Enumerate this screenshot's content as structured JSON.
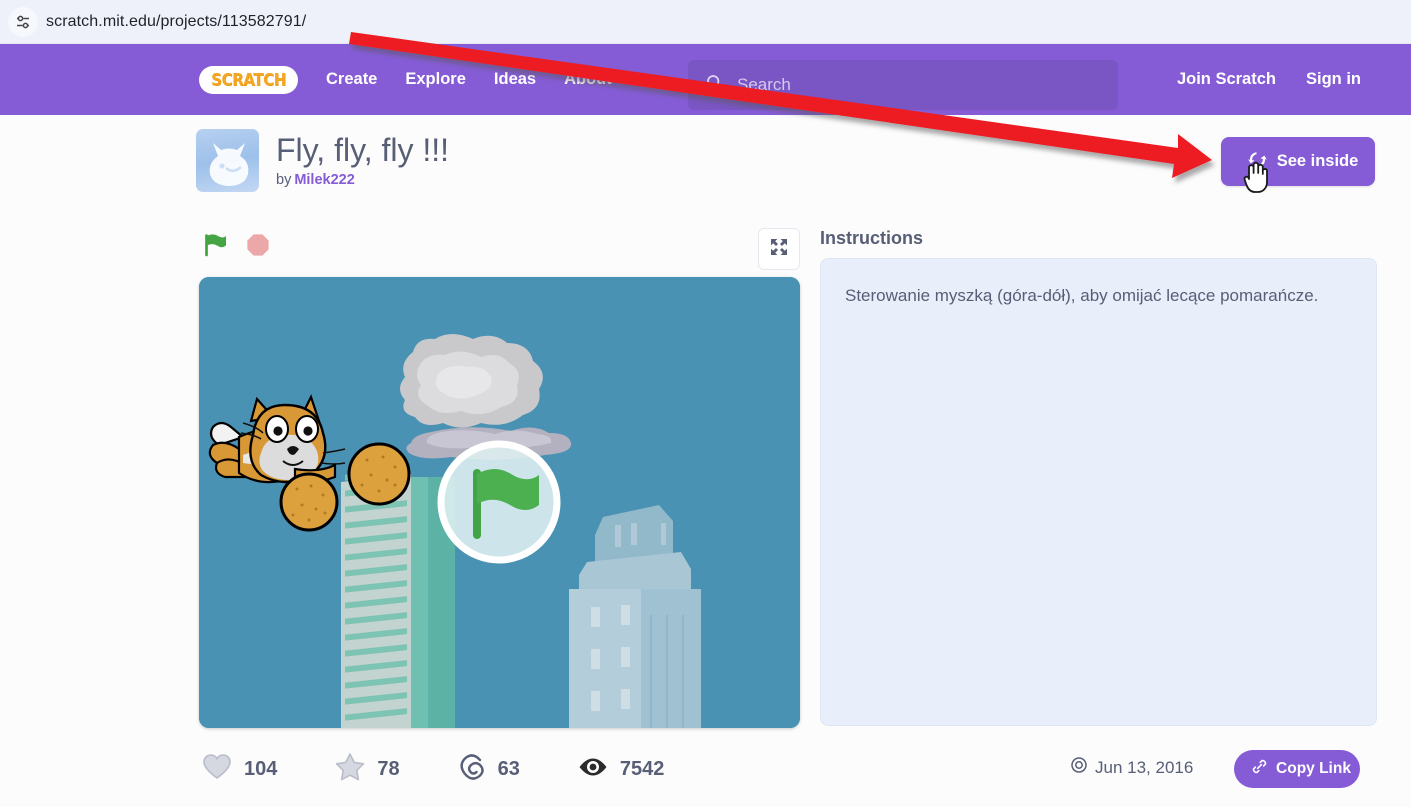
{
  "browser": {
    "url_prefix": "scratch.mit.edu",
    "url_path": "/projects/113582791/",
    "url_full": "scratch.mit.edu/projects/113582791/",
    "site_settings_icon": "tune-icon"
  },
  "nav": {
    "logo_text": "SCRATCH",
    "links": [
      {
        "label": "Create"
      },
      {
        "label": "Explore"
      },
      {
        "label": "Ideas"
      },
      {
        "label": "About"
      }
    ],
    "search": {
      "placeholder": "Search",
      "value": ""
    },
    "join_label": "Join Scratch",
    "signin_label": "Sign in",
    "bar_color": "#855cd6"
  },
  "project": {
    "title": "Fly, fly, fly !!!",
    "by_label": "by",
    "author": "Milek222",
    "see_inside_label": "See inside",
    "accent_color": "#855cd6"
  },
  "stage": {
    "green_flag_label": "Go",
    "stop_label": "Stop",
    "fullscreen_label": "Full Screen",
    "sky_color": "#4a92b3",
    "overlay_flag_color": "#4caf50"
  },
  "instructions": {
    "heading": "Instructions",
    "body": "Sterowanie myszką (góra-dół), aby omijać lecące pomarańcze."
  },
  "stats": [
    {
      "icon": "heart-icon",
      "name": "loves",
      "value": "104"
    },
    {
      "icon": "star-icon",
      "name": "favorites",
      "value": "78"
    },
    {
      "icon": "remix-icon",
      "name": "remixes",
      "value": "63"
    },
    {
      "icon": "eye-icon",
      "name": "views",
      "value": "7542"
    }
  ],
  "footer": {
    "date": "Jun 13, 2016",
    "date_icon": "clock-icon",
    "copy_link_label": "Copy Link",
    "copy_link_icon": "link-icon"
  },
  "annotation": {
    "arrow_color": "#ec1c24",
    "points_to": "See inside"
  }
}
